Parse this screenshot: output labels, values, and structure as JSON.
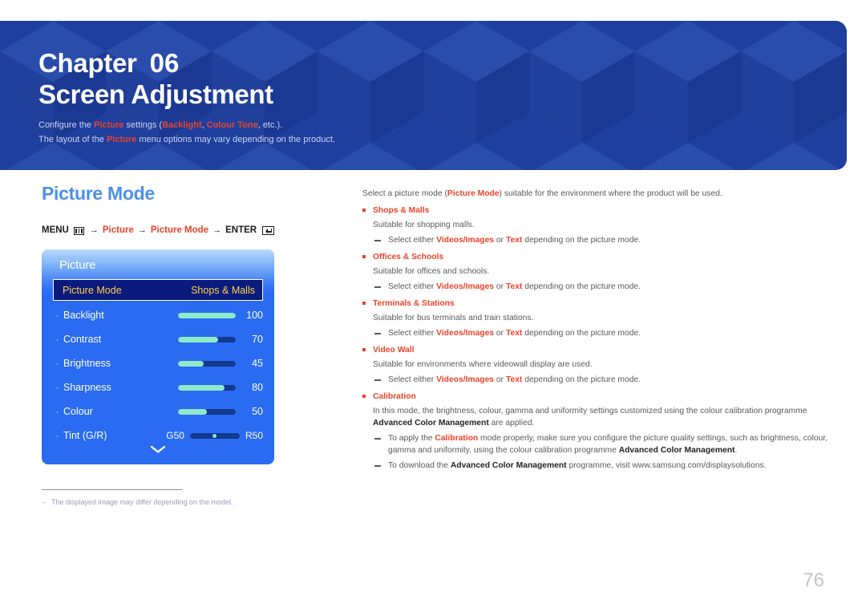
{
  "header": {
    "chapter_word": "Chapter",
    "chapter_number": "06",
    "chapter_title": "Screen Adjustment",
    "subtitle_line1_a": "Configure the ",
    "subtitle_line1_hl1": "Picture",
    "subtitle_line1_b": " settings (",
    "subtitle_line1_hl2": "Backlight",
    "subtitle_line1_c": ", ",
    "subtitle_line1_hl3": "Colour Tone",
    "subtitle_line1_d": ", etc.).",
    "subtitle_line2_a": "The layout of the ",
    "subtitle_line2_hl": "Picture",
    "subtitle_line2_b": " menu options may vary depending on the product.",
    "accent_blue": "#1f3f9e",
    "accent_red": "#e8442a"
  },
  "left": {
    "section_title": "Picture Mode",
    "menu_path": {
      "menu_label": "MENU",
      "menu_icon": "menu-grid-icon",
      "arrow": "→",
      "step1": "Picture",
      "step2": "Picture Mode",
      "enter_label": "ENTER",
      "enter_icon": "enter-key-icon"
    },
    "osd": {
      "title": "Picture",
      "selected_row": {
        "label": "Picture Mode",
        "value": "Shops & Malls"
      },
      "rows": [
        {
          "label": "Backlight",
          "value": "100",
          "percent": 100
        },
        {
          "label": "Contrast",
          "value": "70",
          "percent": 70
        },
        {
          "label": "Brightness",
          "value": "45",
          "percent": 45
        },
        {
          "label": "Sharpness",
          "value": "80",
          "percent": 80
        },
        {
          "label": "Colour",
          "value": "50",
          "percent": 50
        }
      ],
      "tint_row": {
        "label": "Tint (G/R)",
        "left_value": "G50",
        "right_value": "R50"
      },
      "scroll_icon": "chevron-down-icon",
      "panel_color": "#2a6bf2",
      "highlight_color": "#0b1a7d",
      "highlight_text_color": "#ffd24a",
      "slider_fill_color": "#8fe9c8"
    },
    "footnote": "The displayed image may differ depending on the model.",
    "footnote_dash": "–"
  },
  "right": {
    "intro_a": "Select a picture mode (",
    "intro_hl": "Picture Mode",
    "intro_b": ") suitable for the environment where the product will be used.",
    "sub_note_a": "Select either ",
    "sub_note_hl1": "Videos/Images",
    "sub_note_b": " or ",
    "sub_note_hl2": "Text",
    "sub_note_c": " depending on the picture mode.",
    "items": [
      {
        "title": "Shops & Malls",
        "body": "Suitable for shopping malls."
      },
      {
        "title": "Offices & Schools",
        "body": "Suitable for offices and schools."
      },
      {
        "title": "Terminals & Stations",
        "body": "Suitable for bus terminals and train stations."
      },
      {
        "title": "Video Wall",
        "body": "Suitable for environments where videowall display are used."
      }
    ],
    "calibration": {
      "title": "Calibration",
      "body_a": "In this mode, the brightness, colour, gamma and uniformity settings customized using the colour calibration programme ",
      "body_hl": "Advanced Color Management",
      "body_b": " are applied.",
      "note1_a": "To apply the ",
      "note1_hl1": "Calibration",
      "note1_b": " mode properly, make sure you configure the picture quality settings, such as brightness, colour, gamma and uniformity, using the colour calibration programme ",
      "note1_hl2": "Advanced Color Management",
      "note1_c": ".",
      "note2_a": "To download the ",
      "note2_hl": "Advanced Color Management",
      "note2_b": " programme, visit www.samsung.com/displaysolutions."
    }
  },
  "page_number": "76"
}
